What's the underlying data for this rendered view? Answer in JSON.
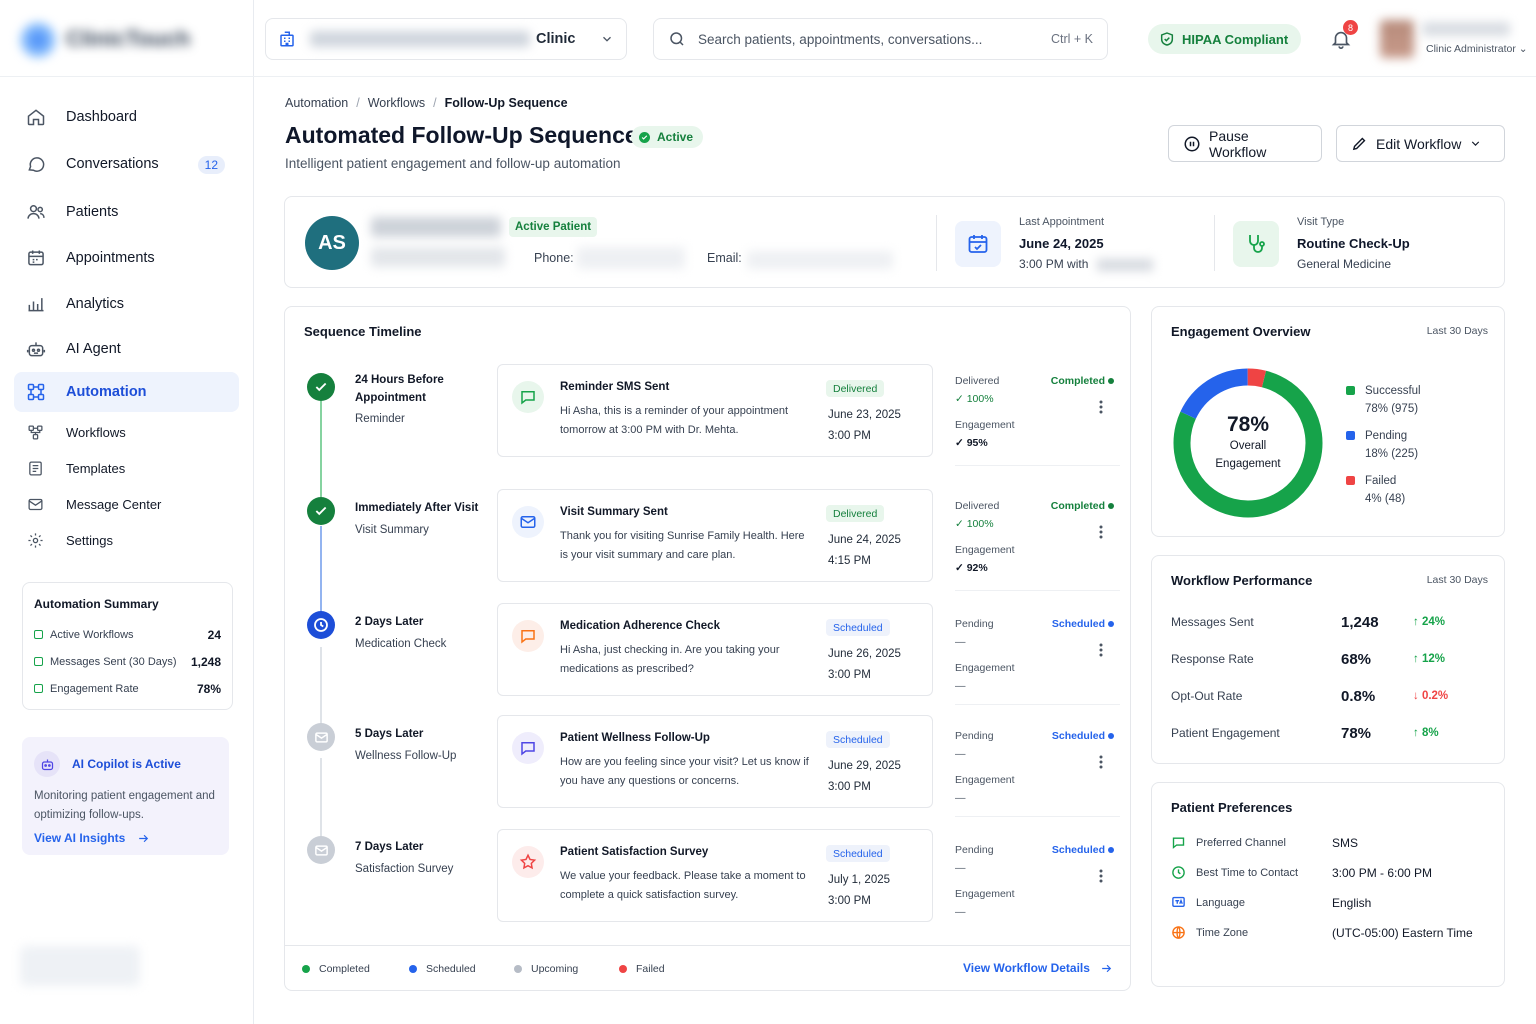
{
  "sidebar": {
    "logo_text": "ClinicTouch",
    "nav": [
      {
        "label": "Dashboard",
        "icon": "home-icon"
      },
      {
        "label": "Conversations",
        "icon": "chat-icon",
        "badge": "12"
      },
      {
        "label": "Patients",
        "icon": "users-icon"
      },
      {
        "label": "Appointments",
        "icon": "calendar-icon"
      },
      {
        "label": "Analytics",
        "icon": "bar-chart-icon"
      },
      {
        "label": "AI Agent",
        "icon": "robot-icon"
      },
      {
        "label": "Automation",
        "icon": "automation-icon",
        "active": true
      }
    ],
    "sub_nav": [
      {
        "label": "Workflows",
        "icon": "workflow-icon"
      },
      {
        "label": "Templates",
        "icon": "template-icon"
      },
      {
        "label": "Message Center",
        "icon": "mail-icon"
      },
      {
        "label": "Settings",
        "icon": "gear-icon"
      }
    ],
    "summary": {
      "title": "Automation Summary",
      "rows": [
        {
          "label": "Active Workflows",
          "value": "24"
        },
        {
          "label": "Messages Sent (30 Days)",
          "value": "1,248"
        },
        {
          "label": "Engagement Rate",
          "value": "78%"
        }
      ]
    },
    "copilot": {
      "title": "AI Copilot is Active",
      "text": "Monitoring patient engagement and optimizing follow-ups.",
      "link": "View AI Insights"
    }
  },
  "topbar": {
    "clinic_label": "Clinic",
    "search_placeholder": "Search patients, appointments, conversations...",
    "search_shortcut": "Ctrl + K",
    "hipaa": "HIPAA Compliant",
    "notification_count": "8",
    "user_role": "Clinic Administrator"
  },
  "breadcrumb": [
    "Automation",
    "Workflows",
    "Follow-Up Sequence"
  ],
  "header": {
    "title": "Automated Follow-Up Sequence",
    "status": "Active",
    "subtitle": "Intelligent patient engagement and follow-up automation",
    "pause_button": "Pause Workflow",
    "edit_button": "Edit Workflow"
  },
  "patient": {
    "initials": "AS",
    "tag": "Active Patient",
    "phone_label": "Phone:",
    "email_label": "Email:",
    "last_appt_label": "Last Appointment",
    "last_appt_date": "June 24, 2025",
    "last_appt_time": "3:00 PM with",
    "visit_type_label": "Visit Type",
    "visit_type": "Routine Check-Up",
    "department": "General Medicine"
  },
  "timeline": {
    "title": "Sequence Timeline",
    "steps": [
      {
        "when": "24 Hours Before Appointment",
        "kind": "Reminder",
        "node": "completed",
        "msg_title": "Reminder SMS Sent",
        "msg_body": "Hi Asha, this is a reminder of your appointment tomorrow at 3:00 PM with Dr. Mehta.",
        "badge": "Delivered",
        "date": "June 23, 2025",
        "time": "3:00 PM",
        "s1_label": "Delivered",
        "s1_value": "✓ 100%",
        "s2_label": "Engagement",
        "s2_value": "✓ 95%",
        "status": "Completed",
        "icon": "chat-icon"
      },
      {
        "when": "Immediately After Visit",
        "kind": "Visit Summary",
        "node": "completed",
        "msg_title": "Visit Summary Sent",
        "msg_body": "Thank you for visiting Sunrise Family Health. Here is your visit summary and care plan.",
        "badge": "Delivered",
        "date": "June 24, 2025",
        "time": "4:15 PM",
        "s1_label": "Delivered",
        "s1_value": "✓ 100%",
        "s2_label": "Engagement",
        "s2_value": "✓ 92%",
        "status": "Completed",
        "icon": "mail-icon"
      },
      {
        "when": "2 Days Later",
        "kind": "Medication Check",
        "node": "scheduled",
        "msg_title": "Medication Adherence Check",
        "msg_body": "Hi Asha, just checking in. Are you taking your medications as prescribed?",
        "badge": "Scheduled",
        "date": "June 26, 2025",
        "time": "3:00 PM",
        "s1_label": "Pending",
        "s1_value": "—",
        "s2_label": "Engagement",
        "s2_value": "—",
        "status": "Scheduled",
        "icon": "chat-icon"
      },
      {
        "when": "5 Days Later",
        "kind": "Wellness Follow-Up",
        "node": "upcoming",
        "msg_title": "Patient Wellness Follow-Up",
        "msg_body": "How are you feeling since your visit? Let us know if you have any questions or concerns.",
        "badge": "Scheduled",
        "date": "June 29, 2025",
        "time": "3:00 PM",
        "s1_label": "Pending",
        "s1_value": "—",
        "s2_label": "Engagement",
        "s2_value": "—",
        "status": "Scheduled",
        "icon": "chat-icon"
      },
      {
        "when": "7 Days Later",
        "kind": "Satisfaction Survey",
        "node": "upcoming",
        "msg_title": "Patient Satisfaction Survey",
        "msg_body": "We value your feedback. Please take a moment to complete a quick satisfaction survey.",
        "badge": "Scheduled",
        "date": "July 1, 2025",
        "time": "3:00 PM",
        "s1_label": "Pending",
        "s1_value": "—",
        "s2_label": "Engagement",
        "s2_value": "—",
        "status": "Scheduled",
        "icon": "star-icon"
      }
    ],
    "legend": [
      "Completed",
      "Scheduled",
      "Upcoming",
      "Failed"
    ],
    "view_details": "View Workflow Details"
  },
  "engagement": {
    "title": "Engagement Overview",
    "range": "Last 30 Days",
    "center_value": "78%",
    "center_line1": "Overall",
    "center_line2": "Engagement",
    "segments": [
      {
        "name": "Successful",
        "value": 78,
        "count": "78% (975)",
        "color": "#16a34a"
      },
      {
        "name": "Pending",
        "value": 18,
        "count": "18% (225)",
        "color": "#2563eb"
      },
      {
        "name": "Failed",
        "value": 4,
        "count": "4% (48)",
        "color": "#ef4444"
      }
    ]
  },
  "performance": {
    "title": "Workflow Performance",
    "range": "Last 30 Days",
    "rows": [
      {
        "label": "Messages Sent",
        "value": "1,248",
        "change": "↑ 24%",
        "dir": "up"
      },
      {
        "label": "Response Rate",
        "value": "68%",
        "change": "↑ 12%",
        "dir": "up"
      },
      {
        "label": "Opt-Out Rate",
        "value": "0.8%",
        "change": "↓ 0.2%",
        "dir": "down"
      },
      {
        "label": "Patient Engagement",
        "value": "78%",
        "change": "↑ 8%",
        "dir": "up"
      }
    ]
  },
  "preferences": {
    "title": "Patient Preferences",
    "rows": [
      {
        "label": "Preferred Channel",
        "value": "SMS",
        "icon": "chat-icon",
        "color": "#16a34a"
      },
      {
        "label": "Best Time to Contact",
        "value": "3:00 PM - 6:00 PM",
        "icon": "clock-icon",
        "color": "#16a34a"
      },
      {
        "label": "Language",
        "value": "English",
        "icon": "language-icon",
        "color": "#2563eb"
      },
      {
        "label": "Time Zone",
        "value": "(UTC-05:00) Eastern Time",
        "icon": "globe-icon",
        "color": "#f97316"
      }
    ]
  },
  "colors": {
    "accent": "#2563eb",
    "success": "#16a34a",
    "danger": "#ef4444",
    "pending_gray": "#9ca3af"
  }
}
